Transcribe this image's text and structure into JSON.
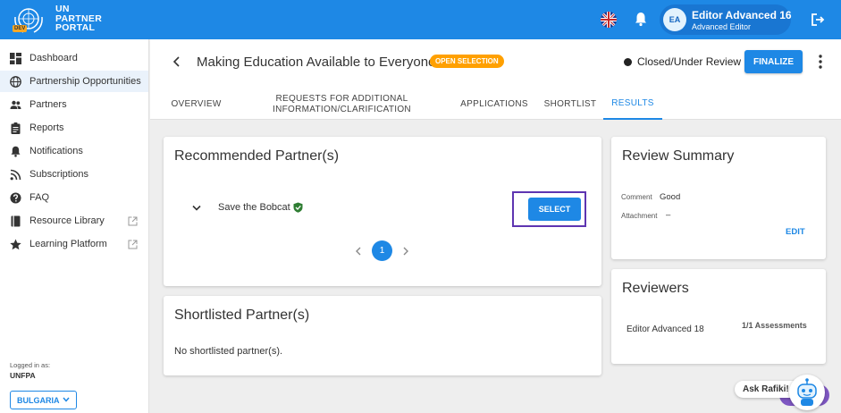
{
  "app": {
    "logo_lines": [
      "UN",
      "PARTNER",
      "PORTAL"
    ],
    "env_badge": "DEV",
    "user": {
      "initials": "EA",
      "name": "Editor Advanced 16",
      "role": "Advanced Editor"
    }
  },
  "sidebar": {
    "items": [
      {
        "label": "Dashboard",
        "icon": "dashboard-icon"
      },
      {
        "label": "Partnership Opportunities",
        "icon": "globe-icon",
        "active": true
      },
      {
        "label": "Partners",
        "icon": "people-icon"
      },
      {
        "label": "Reports",
        "icon": "clipboard-icon"
      },
      {
        "label": "Notifications",
        "icon": "bell-icon"
      },
      {
        "label": "Subscriptions",
        "icon": "rss-icon"
      },
      {
        "label": "FAQ",
        "icon": "help-icon"
      },
      {
        "label": "Resource Library",
        "icon": "book-icon",
        "external": true
      },
      {
        "label": "Learning Platform",
        "icon": "star-icon",
        "external": true
      }
    ],
    "logged_in_label": "Logged in as:",
    "organization": "UNFPA",
    "country": "BULGARIA"
  },
  "header": {
    "title": "Making Education Available to Everyone",
    "status_chip": "OPEN SELECTION",
    "review_status": "Closed/Under Review",
    "finalize_label": "FINALIZE",
    "tabs": [
      {
        "label": "OVERVIEW"
      },
      {
        "label": "REQUESTS FOR ADDITIONAL INFORMATION/CLARIFICATION"
      },
      {
        "label": "APPLICATIONS"
      },
      {
        "label": "SHORTLIST"
      },
      {
        "label": "RESULTS",
        "active": true
      }
    ]
  },
  "recommended": {
    "title": "Recommended Partner(s)",
    "partner_name": "Save the Bobcat",
    "select_label": "SELECT",
    "current_page": "1"
  },
  "shortlisted": {
    "title": "Shortlisted Partner(s)",
    "empty_text": "No shortlisted partner(s)."
  },
  "review_summary": {
    "title": "Review Summary",
    "comment_label": "Comment",
    "comment_value": "Good",
    "attachment_label": "Attachment",
    "attachment_value": "–",
    "edit_label": "EDIT"
  },
  "reviewers": {
    "title": "Reviewers",
    "items": [
      {
        "name": "Editor Advanced 18",
        "assessments": "1/1 Assessments"
      }
    ]
  },
  "chatbot": {
    "label": "Ask Rafiki!"
  },
  "colors": {
    "primary": "#1e88e5",
    "status_chip": "#ffa000",
    "highlight_border": "#5e35b1"
  }
}
